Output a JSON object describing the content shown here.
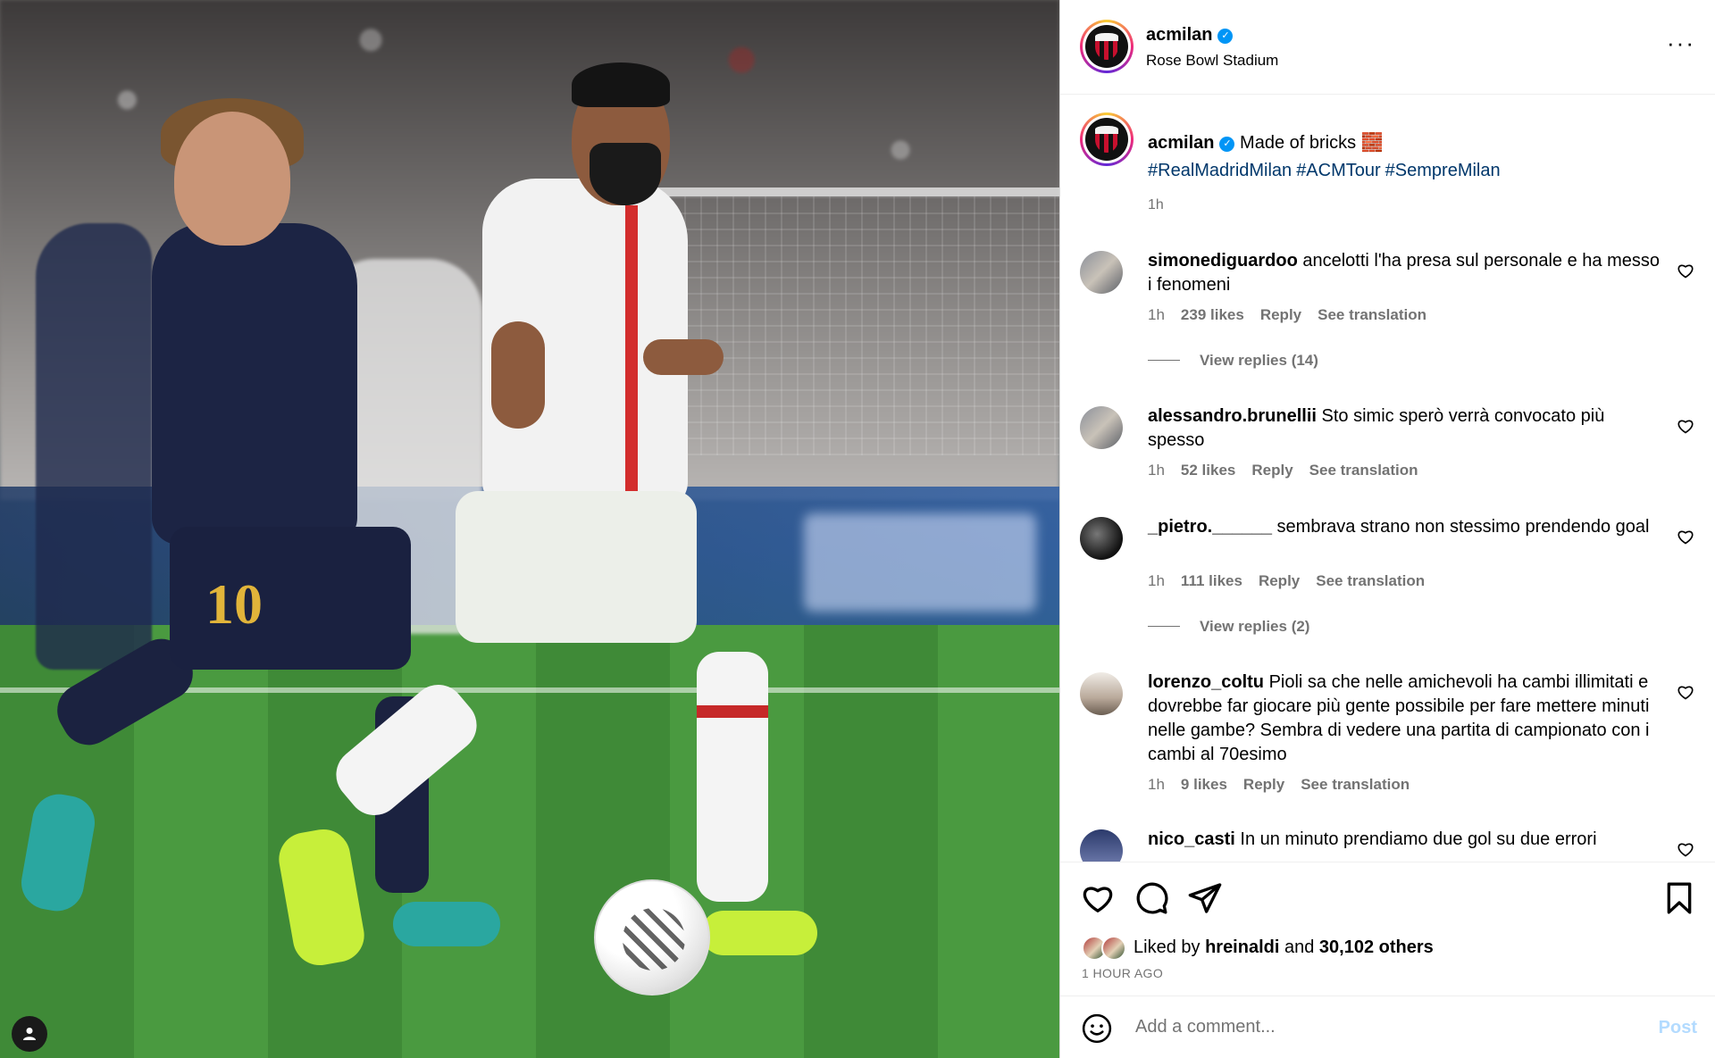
{
  "post": {
    "account": "acmilan",
    "location": "Rose Bowl Stadium",
    "caption": "Made of bricks 🧱",
    "hashtags": [
      "#RealMadridMilan",
      "#ACMTour",
      "#SempreMilan"
    ],
    "caption_time": "1h",
    "jersey_number": "10"
  },
  "comments": [
    {
      "user": "simonediguardoo",
      "text": "ancelotti l'ha presa sul personale e ha messo i fenomeni",
      "time": "1h",
      "likes": "239 likes",
      "reply": "Reply",
      "translate": "See translation",
      "view_replies": "View replies (14)"
    },
    {
      "user": "alessandro.brunellii",
      "text": "Sto simic sperò verrà convocato più spesso",
      "time": "1h",
      "likes": "52 likes",
      "reply": "Reply",
      "translate": "See translation"
    },
    {
      "user": "_pietro.______",
      "text": "sembrava strano non stessimo prendendo goal",
      "time": "1h",
      "likes": "111 likes",
      "reply": "Reply",
      "translate": "See translation",
      "view_replies": "View replies (2)"
    },
    {
      "user": "lorenzo_coltu",
      "text": "Pioli sa che nelle amichevoli ha cambi illimitati e dovrebbe far giocare più gente possibile per fare mettere minuti nelle gambe? Sembra di vedere una partita di campionato con i cambi al 70esimo",
      "time": "1h",
      "likes": "9 likes",
      "reply": "Reply",
      "translate": "See translation"
    },
    {
      "user": "nico_casti",
      "text": "In un minuto prendiamo due gol su due errori"
    }
  ],
  "actions": {
    "liked_by_prefix": "Liked by",
    "liked_by_user": "hreinaldi",
    "liked_by_and": "and",
    "liked_by_others": "30,102 others",
    "time": "1 HOUR AGO"
  },
  "add_comment": {
    "placeholder": "Add a comment...",
    "post_label": "Post"
  },
  "icons": {
    "more": "more-options-icon",
    "like": "heart-icon",
    "comment": "comment-icon",
    "share": "share-icon",
    "save": "bookmark-icon",
    "emoji": "emoji-icon",
    "user_tag": "user-tag-icon"
  },
  "colors": {
    "link": "#00376b",
    "muted": "#737373",
    "verified": "#0095f6",
    "post_disabled": "#b3dbff"
  }
}
